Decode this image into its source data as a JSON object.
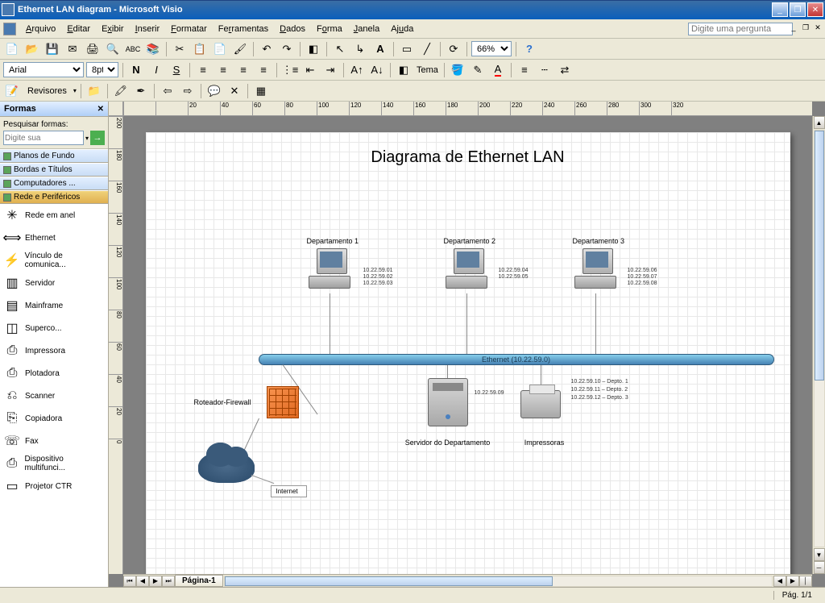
{
  "window": {
    "title": "Ethernet LAN diagram - Microsoft Visio"
  },
  "menu": {
    "items": [
      "Arquivo",
      "Editar",
      "Exibir",
      "Inserir",
      "Formatar",
      "Ferramentas",
      "Dados",
      "Forma",
      "Janela",
      "Ajuda"
    ],
    "ask_placeholder": "Digite uma pergunta"
  },
  "toolbar": {
    "font": "Arial",
    "size": "8pt",
    "zoom": "66%",
    "tema_label": "Tema",
    "reviewers_label": "Revisores"
  },
  "shapes_panel": {
    "title": "Formas",
    "search_label": "Pesquisar formas:",
    "search_placeholder": "Digite sua",
    "stencils": [
      "Planos de Fundo",
      "Bordas e Títulos",
      "Computadores ...",
      "Rede e Periféricos"
    ],
    "shapes": [
      {
        "icon": "✳",
        "label": "Rede em anel"
      },
      {
        "icon": "⟺",
        "label": "Ethernet"
      },
      {
        "icon": "⚡",
        "label": "Vínculo de comunica..."
      },
      {
        "icon": "▥",
        "label": "Servidor"
      },
      {
        "icon": "▤",
        "label": "Mainframe"
      },
      {
        "icon": "◫",
        "label": "Superco..."
      },
      {
        "icon": "⎙",
        "label": "Impressora"
      },
      {
        "icon": "⎙",
        "label": "Plotadora"
      },
      {
        "icon": "⎌",
        "label": "Scanner"
      },
      {
        "icon": "⎘",
        "label": "Copiadora"
      },
      {
        "icon": "☏",
        "label": "Fax"
      },
      {
        "icon": "⎙",
        "label": "Dispositivo multifunci..."
      },
      {
        "icon": "▭",
        "label": "Projetor CTR"
      }
    ]
  },
  "diagram": {
    "title": "Diagrama de Ethernet LAN",
    "departments": [
      {
        "label": "Departamento 1",
        "ips": [
          "10.22.59.01",
          "10.22.59.02",
          "10.22.59.03"
        ]
      },
      {
        "label": "Departamento 2",
        "ips": [
          "10.22.59.04",
          "10.22.59.05"
        ]
      },
      {
        "label": "Departamento 3",
        "ips": [
          "10.22.59.06",
          "10.22.59.07",
          "10.22.59.08"
        ]
      }
    ],
    "ethernet_label": "Ethernet (10.22.59.0)",
    "firewall_label": "Roteador-Firewall",
    "server_label": "Servidor do Departamento",
    "server_ip": "10.22.59.09",
    "printer_label": "Impressoras",
    "printer_ips": [
      "10.22.59.10 – Depto. 1",
      "10.22.59.11 – Depto. 2",
      "10.22.59.12 – Depto. 3"
    ],
    "internet_label": "Internet"
  },
  "tabs": {
    "page1": "Página-1"
  },
  "status": {
    "page": "Pág. 1/1"
  },
  "ruler_h": [
    "",
    "",
    "20",
    "40",
    "60",
    "80",
    "100",
    "120",
    "140",
    "160",
    "180",
    "200",
    "220",
    "240",
    "260",
    "280",
    "300",
    "320"
  ],
  "ruler_v": [
    "200",
    "180",
    "160",
    "140",
    "120",
    "100",
    "80",
    "60",
    "40",
    "20",
    "0"
  ]
}
